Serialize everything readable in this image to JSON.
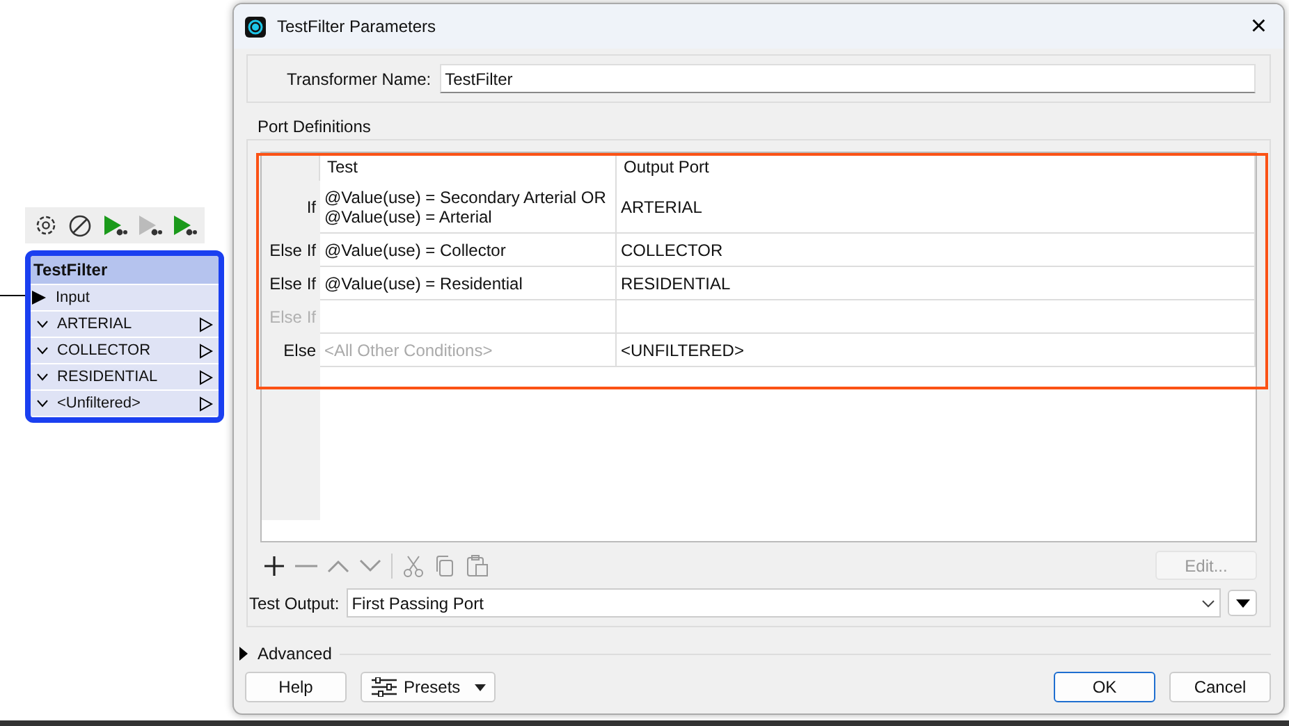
{
  "canvas": {
    "toolbar": [
      {
        "kind": "settings",
        "disabled": false
      },
      {
        "kind": "block",
        "disabled": false
      },
      {
        "kind": "run",
        "disabled": false
      },
      {
        "kind": "run",
        "disabled": true
      },
      {
        "kind": "run",
        "disabled": false
      }
    ],
    "node": {
      "title": "TestFilter",
      "input": "Input",
      "outputs": [
        "ARTERIAL",
        "COLLECTOR",
        "RESIDENTIAL",
        "<Unfiltered>"
      ]
    }
  },
  "dialog": {
    "title": "TestFilter Parameters",
    "close": "×",
    "transformer_name": {
      "label": "Transformer Name:",
      "value": "TestFilter"
    },
    "port_definitions": {
      "title": "Port Definitions",
      "columns": [
        "Test",
        "Output Port"
      ],
      "rows": [
        {
          "label": "If",
          "test": "@Value(use) = Secondary Arterial OR\n@Value(use) = Arterial",
          "port": "ARTERIAL",
          "disabled": false
        },
        {
          "label": "Else If",
          "test": "@Value(use) = Collector",
          "port": "COLLECTOR",
          "disabled": false
        },
        {
          "label": "Else If",
          "test": "@Value(use) = Residential",
          "port": "RESIDENTIAL",
          "disabled": false
        },
        {
          "label": "Else If",
          "disabled": true
        },
        {
          "label": "Else",
          "placeholder": "<All Other Conditions>",
          "port": "<UNFILTERED>",
          "disabled": false
        }
      ],
      "tools": [
        {
          "kind": "add",
          "disabled": false
        },
        {
          "kind": "remove",
          "disabled": true
        },
        {
          "kind": "up",
          "disabled": true
        },
        {
          "kind": "down",
          "disabled": true
        },
        {
          "kind": "cut",
          "disabled": true
        },
        {
          "kind": "copy",
          "disabled": true
        },
        {
          "kind": "paste",
          "disabled": true
        }
      ],
      "edit_button": {
        "label": "Edit...",
        "disabled": true
      },
      "test_output": {
        "label": "Test Output:",
        "value": "First Passing Port"
      }
    },
    "advanced": {
      "label": "Advanced",
      "expanded": false
    },
    "buttons": {
      "help": "Help",
      "presets": "Presets",
      "ok": "OK",
      "cancel": "Cancel"
    }
  }
}
